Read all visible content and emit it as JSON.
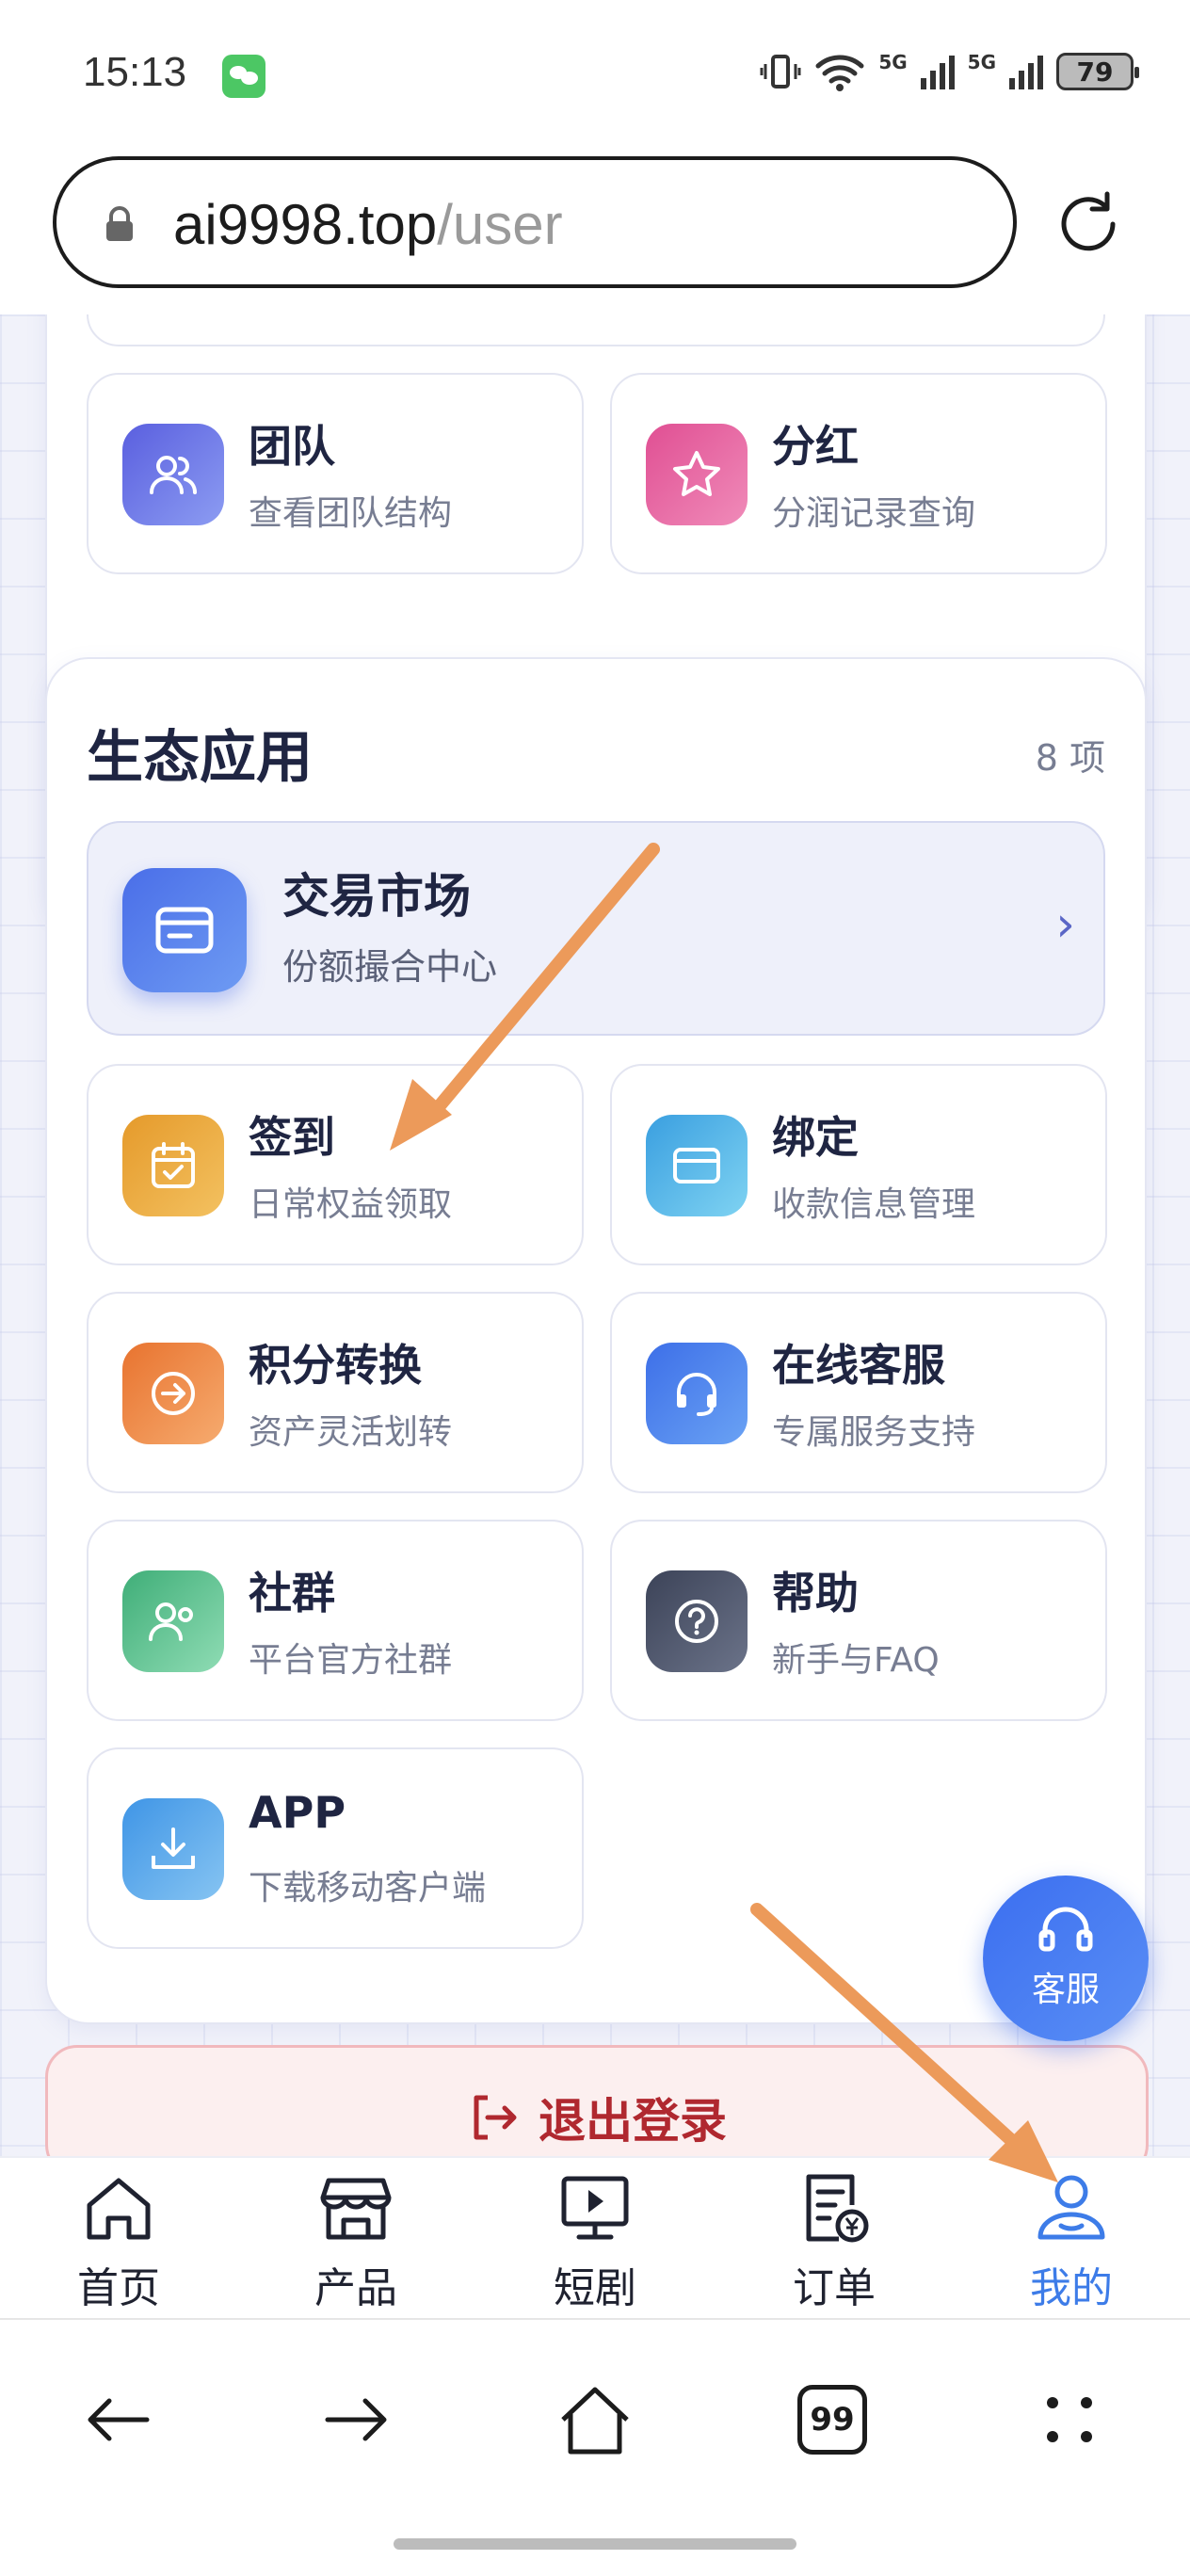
{
  "status_bar": {
    "time": "15:13",
    "signal_1": "5G",
    "signal_2": "5G",
    "battery": "79"
  },
  "browser": {
    "url_host": "ai9998.top",
    "url_path": "/user"
  },
  "top_cards": [
    {
      "title": "团队",
      "subtitle": "查看团队结构",
      "icon": "users-icon",
      "color": "#6c72e6"
    },
    {
      "title": "分红",
      "subtitle": "分润记录查询",
      "icon": "star-icon",
      "color": "#e8609f"
    }
  ],
  "eco_section": {
    "title": "生态应用",
    "count": "8 项",
    "featured": {
      "title": "交易市场",
      "subtitle": "份额撮合中心",
      "icon": "wallet-icon",
      "chevron": "›"
    },
    "cards": [
      {
        "title": "签到",
        "subtitle": "日常权益领取",
        "icon": "calendar-check-icon",
        "color": "#e9a537"
      },
      {
        "title": "绑定",
        "subtitle": "收款信息管理",
        "icon": "card-icon",
        "color": "#4fb6e8"
      },
      {
        "title": "积分转换",
        "subtitle": "资产灵活划转",
        "icon": "arrow-circle-icon",
        "color": "#ef8a47"
      },
      {
        "title": "在线客服",
        "subtitle": "专属服务支持",
        "icon": "headset-icon",
        "color": "#4a7ff0"
      },
      {
        "title": "社群",
        "subtitle": "平台官方社群",
        "icon": "community-icon",
        "color": "#56c28c"
      },
      {
        "title": "帮助",
        "subtitle": "新手与FAQ",
        "icon": "help-icon",
        "color": "#4d556c"
      },
      {
        "title": "APP",
        "subtitle": "下载移动客户端",
        "icon": "download-icon",
        "color": "#58a8ea"
      }
    ]
  },
  "floating_support": {
    "label": "客服"
  },
  "logout": {
    "label": "退出登录"
  },
  "tab_bar": [
    {
      "label": "首页",
      "icon": "home-icon"
    },
    {
      "label": "产品",
      "icon": "store-icon"
    },
    {
      "label": "短剧",
      "icon": "play-screen-icon"
    },
    {
      "label": "订单",
      "icon": "order-icon"
    },
    {
      "label": "我的",
      "icon": "profile-icon",
      "active": true
    }
  ],
  "browser_nav": {
    "tabs_count": "99"
  },
  "colors": {
    "accent_blue": "#3d7ce8",
    "logout_red": "#b0282f",
    "annotation_arrow": "#ec9a5a"
  }
}
